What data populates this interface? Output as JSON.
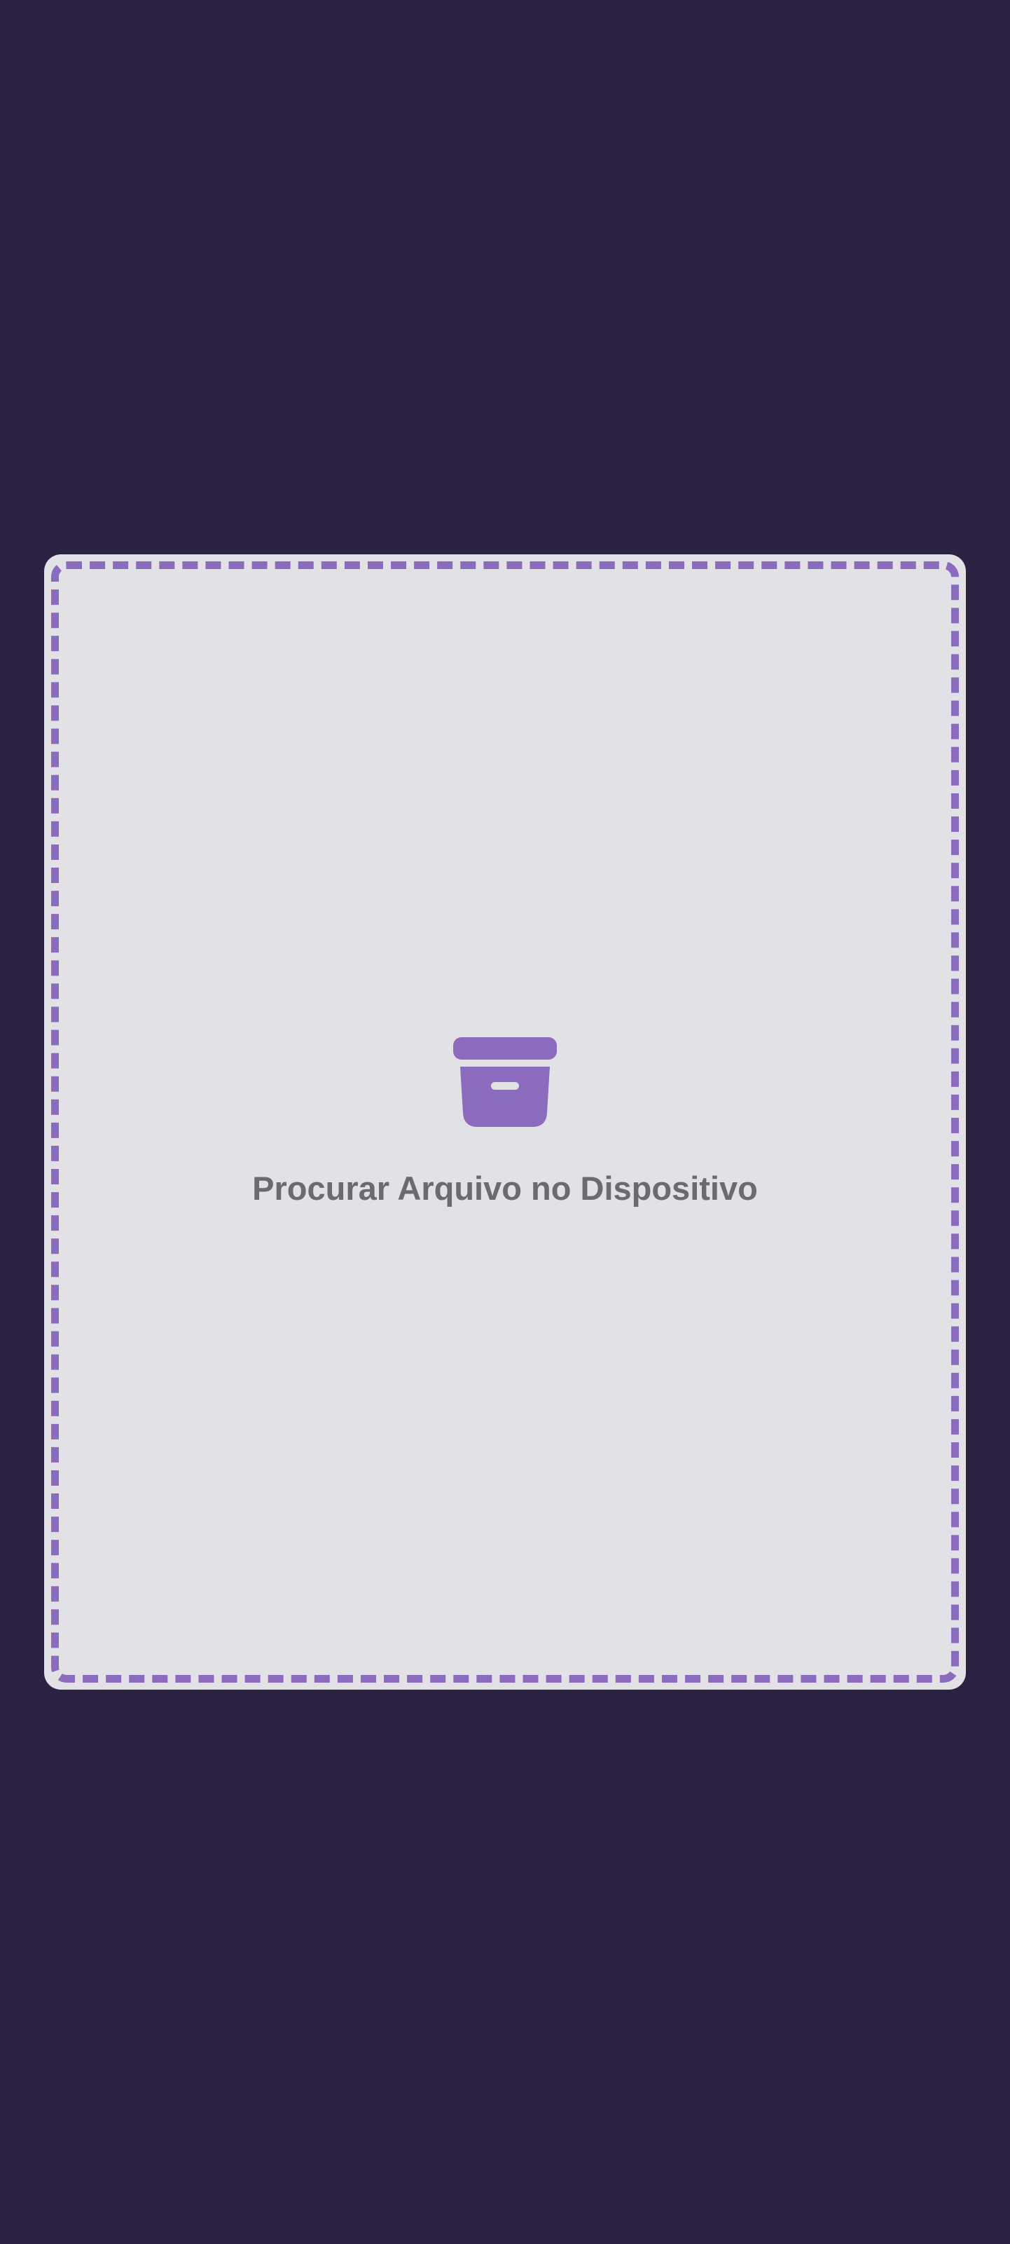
{
  "colors": {
    "background": "#2a2240",
    "card": "#e2e1e6",
    "accent": "#8b6bbd",
    "label_text": "#6b6b6e"
  },
  "upload": {
    "icon": "archive-box-icon",
    "label": "Procurar Arquivo no Dispositivo"
  }
}
